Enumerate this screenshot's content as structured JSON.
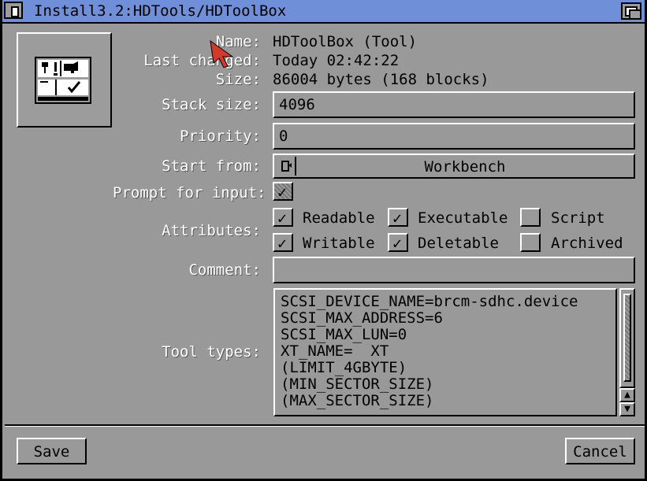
{
  "window": {
    "title": "Install3.2:HDTools/HDToolBox",
    "accent_color": "#6f8fd8"
  },
  "info": {
    "name_label": "Name:",
    "name_value": "HDToolBox (Tool)",
    "changed_label": "Last changed:",
    "changed_value": "Today 02:42:22",
    "size_label": "Size:",
    "size_value": "86004 bytes (168 blocks)"
  },
  "stack": {
    "label": "Stack size:",
    "value": "4096"
  },
  "priority": {
    "label": "Priority:",
    "value": "0"
  },
  "start_from": {
    "label": "Start from:",
    "value": "Workbench"
  },
  "prompt": {
    "label": "Prompt for input:",
    "checked": true
  },
  "attributes": {
    "label": "Attributes:",
    "readable": {
      "label": "Readable",
      "checked": true
    },
    "executable": {
      "label": "Executable",
      "checked": true
    },
    "script": {
      "label": "Script",
      "checked": false
    },
    "writable": {
      "label": "Writable",
      "checked": true
    },
    "deletable": {
      "label": "Deletable",
      "checked": true
    },
    "archived": {
      "label": "Archived",
      "checked": false
    }
  },
  "comment": {
    "label": "Comment:",
    "value": ""
  },
  "tooltypes": {
    "label": "Tool types:",
    "items": [
      "SCSI_DEVICE_NAME=brcm-sdhc.device",
      "SCSI_MAX_ADDRESS=6",
      "SCSI_MAX_LUN=0",
      "XT_NAME=  XT",
      "(LIMIT_4GBYTE)",
      "(MIN_SECTOR_SIZE)",
      "(MAX_SECTOR_SIZE)"
    ]
  },
  "buttons": {
    "save": "Save",
    "cancel": "Cancel"
  },
  "icons": {
    "close": "close-gadget-icon",
    "depth": "depth-gadget-icon",
    "tool": "hdtoolbox-tool-icon",
    "cycle": "cycle-icon",
    "check": "checkmark-icon",
    "up": "arrow-up-icon",
    "down": "arrow-down-icon",
    "pointer": "mouse-pointer-icon"
  }
}
